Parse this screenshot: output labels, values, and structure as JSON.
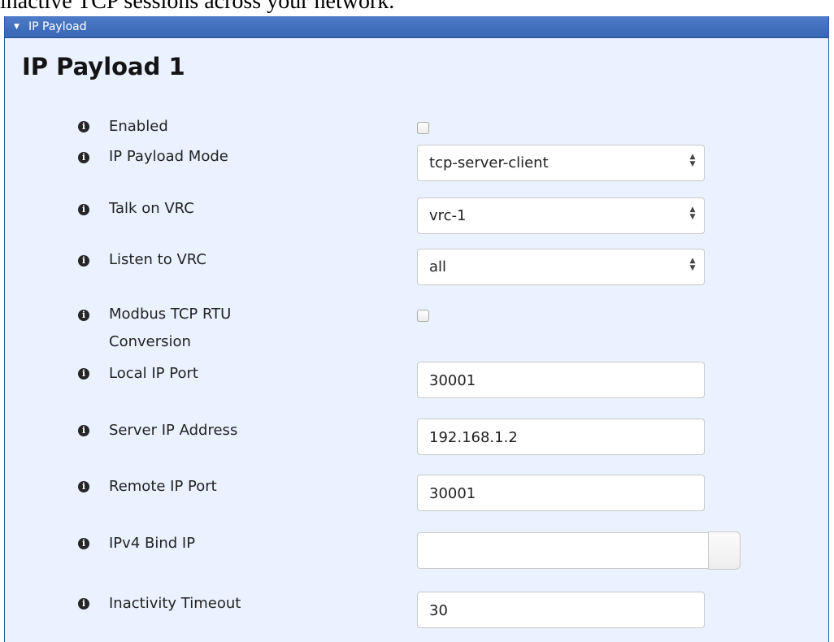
{
  "top_text": "inactive TCP sessions across your network.",
  "panel": {
    "header_label": "IP Payload",
    "caret_icon": "caret-down-icon",
    "section_title": "IP Payload 1"
  },
  "fields": {
    "enabled": {
      "label": "Enabled",
      "checked": false
    },
    "mode": {
      "label": "IP Payload Mode",
      "value": "tcp-server-client"
    },
    "talk_vrc": {
      "label": "Talk on VRC",
      "value": "vrc-1"
    },
    "listen_vrc": {
      "label": "Listen to VRC",
      "value": "all"
    },
    "modbus": {
      "label_line1": "Modbus TCP RTU",
      "label_line2": "Conversion",
      "checked": false
    },
    "local_port": {
      "label": "Local IP Port",
      "value": "30001"
    },
    "server_ip": {
      "label": "Server IP Address",
      "value": "192.168.1.2"
    },
    "remote_port": {
      "label": "Remote IP Port",
      "value": "30001"
    },
    "bind_ip": {
      "label": "IPv4 Bind IP",
      "value": ""
    },
    "timeout": {
      "label": "Inactivity Timeout",
      "value": "30"
    }
  },
  "icons": {
    "info": "info-icon",
    "select_arrows": "updown-arrows-icon"
  },
  "colors": {
    "header_blue": "#3f6fbf",
    "panel_bg": "#eaf2ff"
  }
}
